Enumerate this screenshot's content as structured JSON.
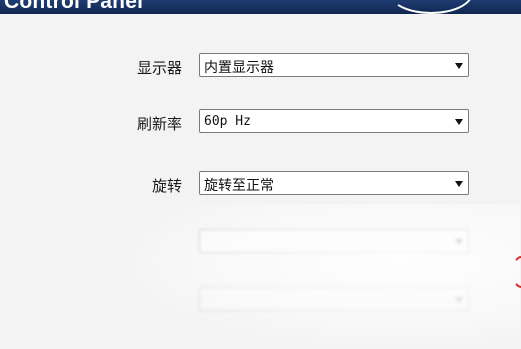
{
  "window": {
    "title": "Control Panel"
  },
  "form": {
    "rows": [
      {
        "label": "显示器",
        "value": "内置显示器"
      },
      {
        "label": "刷新率",
        "value": "60p Hz"
      },
      {
        "label": "旋转",
        "value": "旋转至正常"
      },
      {
        "label": "",
        "value": ""
      },
      {
        "label": "",
        "value": ""
      }
    ]
  },
  "colors": {
    "titlebar": "#1f3d72",
    "accent_mark": "#e0281e"
  }
}
